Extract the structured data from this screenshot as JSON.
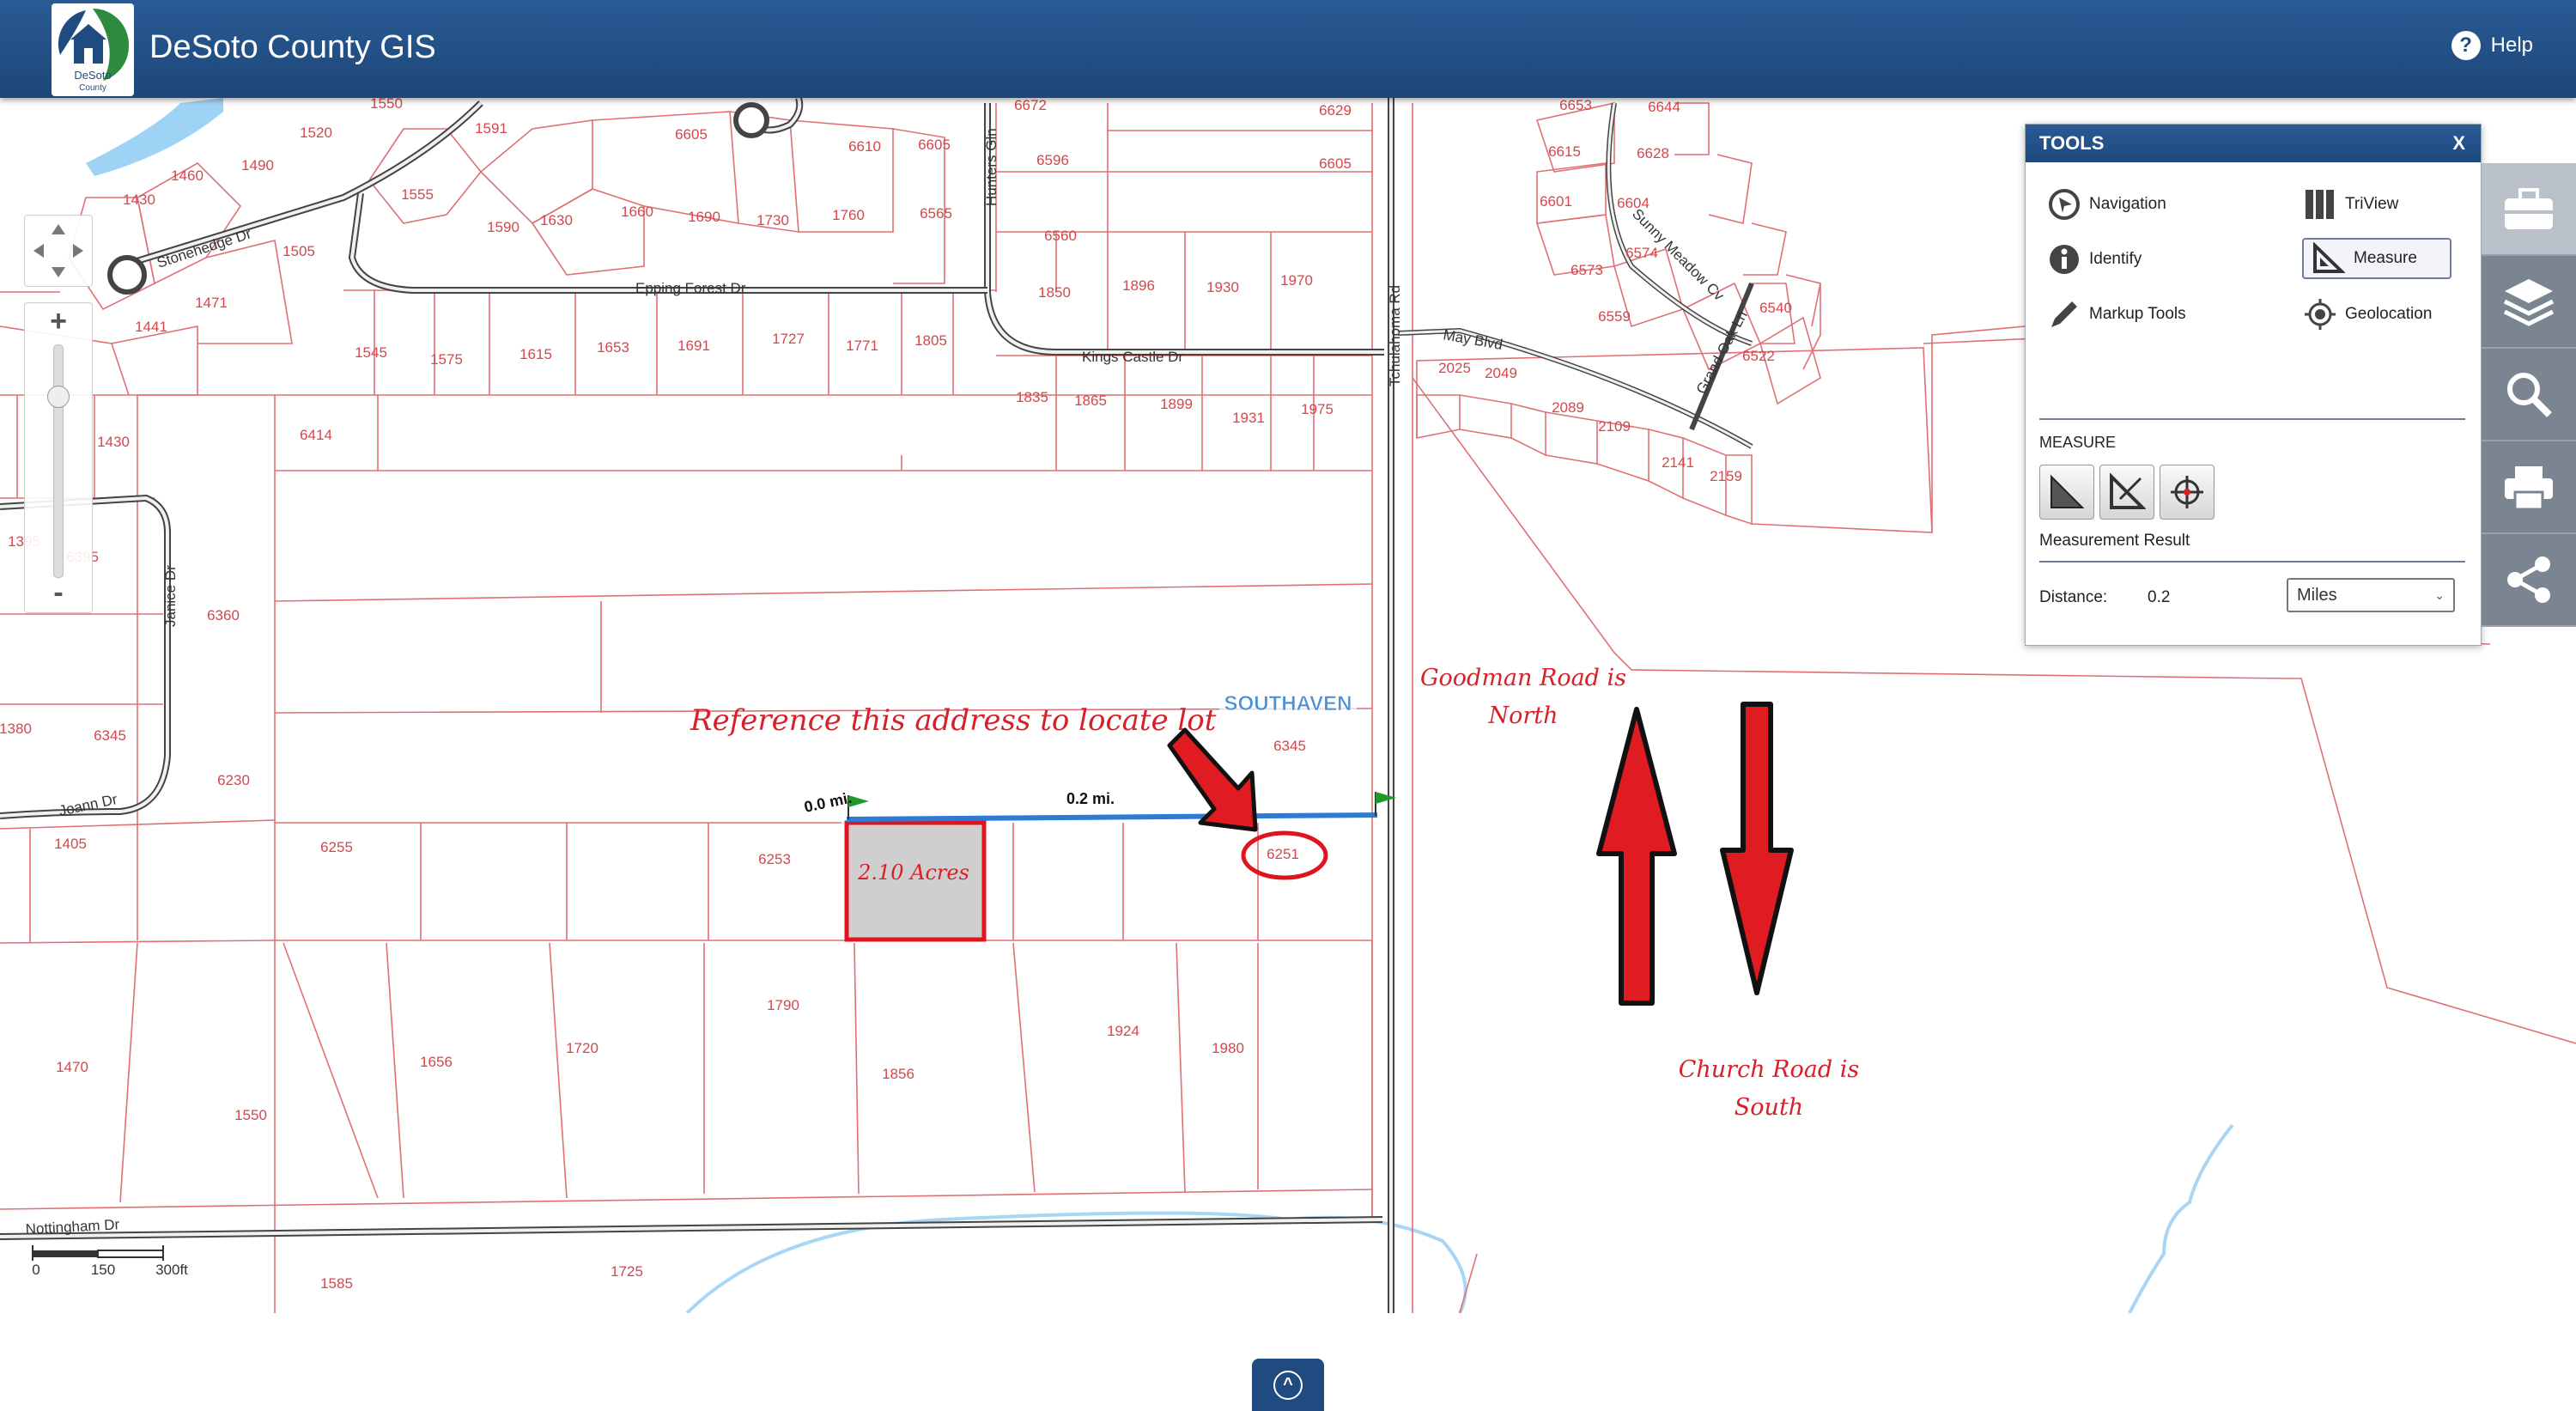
{
  "app": {
    "title": "DeSoto County GIS",
    "help_label": "Help",
    "logo_text": "DeSoto County"
  },
  "map": {
    "zoom_in": "+",
    "zoom_out": "-",
    "city_label": "SOUTHAVEN",
    "roads": [
      "Stonehedge Dr",
      "Epping Forest Dr",
      "Hunters Gln",
      "Kings Castle Dr",
      "Tchulahoma Rd",
      "May Blvd",
      "Sunny Meadow Cv",
      "Grand Oak Ln",
      "Janice Dr",
      "Joann Dr",
      "Nottingham Dr"
    ],
    "parcels": [
      "1550",
      "1591",
      "6605",
      "6672",
      "6629",
      "6653",
      "6644",
      "1520",
      "1460",
      "1490",
      "1430",
      "6610",
      "6605",
      "6596",
      "6605",
      "6615",
      "6628",
      "1555",
      "1590",
      "1630",
      "1660",
      "1690",
      "1730",
      "1760",
      "6565",
      "6601",
      "6604",
      "1505",
      "6560",
      "6574",
      "1471",
      "1441",
      "1850",
      "1896",
      "1930",
      "1970",
      "6573",
      "6540",
      "1545",
      "1575",
      "1615",
      "1653",
      "1691",
      "1727",
      "1771",
      "1805",
      "6559",
      "6522",
      "2025",
      "2049",
      "2089",
      "2109",
      "2141",
      "2159",
      "1430",
      "6414",
      "1835",
      "1865",
      "1899",
      "1931",
      "1975",
      "1395",
      "6395",
      "6360",
      "1380",
      "6345",
      "6230",
      "6345",
      "1405",
      "6255",
      "6253",
      "6251",
      "1790",
      "1924",
      "1980",
      "1470",
      "1656",
      "1720",
      "1856",
      "1550",
      "1585",
      "1725"
    ],
    "measure_start": "0.0 mi.",
    "measure_mid": "0.2 mi.",
    "lot_label": "2.10 Acres",
    "annotations": {
      "reference": "Reference this address to locate lot",
      "goodman_1": "Goodman Road is",
      "goodman_2": "North",
      "church_1": "Church Road is",
      "church_2": "South"
    },
    "scale": {
      "t0": "0",
      "t1": "150",
      "t2": "300ft"
    },
    "expand_label": "^"
  },
  "tools": {
    "title": "TOOLS",
    "close": "X",
    "items": [
      "Navigation",
      "TriView",
      "Identify",
      "Measure",
      "Markup Tools",
      "Geolocation"
    ],
    "measure_heading": "MEASURE",
    "result_label": "Measurement Result",
    "distance_label": "Distance:",
    "distance_value": "0.2",
    "unit_options": [
      "Miles"
    ],
    "unit_selected": "Miles"
  },
  "colors": {
    "header": "#1f4b80",
    "parcel_line": "#d8454a",
    "measure_line": "#2e7bd6",
    "annotation": "#d8202a",
    "side_bar": "#7a8591"
  },
  "icons": [
    "navigation-icon",
    "triview-icon",
    "identify-icon",
    "measure-icon",
    "pencil-icon",
    "geolocation-icon",
    "toolbox-icon",
    "layers-icon",
    "search-icon",
    "print-icon",
    "share-icon",
    "help-icon"
  ]
}
